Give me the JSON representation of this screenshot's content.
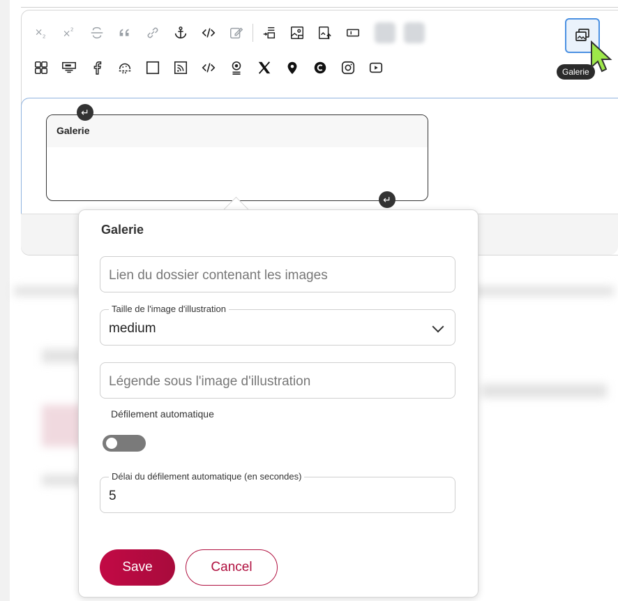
{
  "toolbar": {
    "row1": [
      "subscript-icon",
      "superscript-icon",
      "strikethrough-icon",
      "quote-icon",
      "link-icon",
      "anchor-icon",
      "code-icon",
      "edit-icon",
      "indent-icon",
      "image-frame-icon",
      "image-upload-icon",
      "input-field-icon"
    ],
    "row2": [
      "grid-icon",
      "widget-icon",
      "facebook-icon",
      "cookie-icon",
      "square-icon",
      "rss-icon",
      "embed-code-icon",
      "podcast-icon",
      "x-twitter-icon",
      "location-pin-icon",
      "copyright-icon",
      "instagram-icon",
      "youtube-icon"
    ],
    "gallery_tooltip": "Galerie"
  },
  "editor": {
    "block_title": "Galerie"
  },
  "popover": {
    "title": "Galerie",
    "folder_link_placeholder": "Lien du dossier contenant les images",
    "image_size_label": "Taille de l'image d'illustration",
    "image_size_value": "medium",
    "caption_placeholder": "Légende sous l'image d'illustration",
    "autoplay_label": "Défilement automatique",
    "autoplay_on": false,
    "delay_label": "Délai du défilement automatique (en secondes)",
    "delay_value": "5",
    "save_label": "Save",
    "cancel_label": "Cancel"
  },
  "colors": {
    "accent": "#c20a45",
    "selection_border": "#4a90e2"
  }
}
